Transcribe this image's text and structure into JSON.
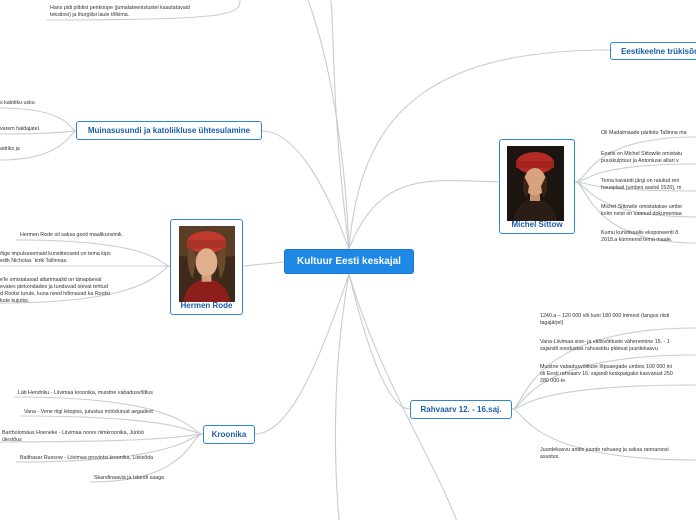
{
  "central": {
    "label": "Kultuur Eesti keskajal"
  },
  "nodes": {
    "eestikeelne": {
      "label": "Eestikeelne trükisõn"
    },
    "muinasusund": {
      "label": "Muinasusundi ja katoliikluse ühtesulamine"
    },
    "kroonika": {
      "label": "Kroonika"
    },
    "rahvaarv": {
      "label": "Rahvaarv 12. - 16.saj."
    },
    "sittow": {
      "label": "Michel Sittow"
    },
    "rode": {
      "label": "Hermen Rode"
    }
  },
  "leaves": {
    "top": [
      "Hans pidi piiblist perikoope (jumalateenistustel kasutatavaid",
      "tekstiosi) ja liturgilisi laule tõlkima."
    ],
    "muinasusund": [
      [
        "s katoliku usku"
      ],
      [
        "varem haldajatel."
      ],
      [
        "adriks ja"
      ]
    ],
    "rode": [
      [
        "Hermen Rode oli saksa gooti maalikunstnik."
      ],
      [
        "õige impulsseemaid kunstiteoseid on tema kips",
        "edik Nicholas ´kirik Tallinnas."
      ],
      [
        "e'le omistatavad altarimaalid on tänapäeval",
        "evates piirkondades ja tunduvad olevat tehtud",
        "d Rootsi turule, kuna need hõlmavad ka Rootsi",
        "kute kujutisi."
      ]
    ],
    "kroonika": [
      [
        "Läti Hendriku - Liivimaa kroonika, muistne vabadusvõitlus"
      ],
      [
        "Vana - Vene riigi letopiss, jutustus möödunud aegadest"
      ],
      [
        "Bartholomäus Hoeneke - Liivimaa noore riimkroonika, Jüriöö",
        "ülestõus"
      ],
      [
        "Balthasar Russow - Liivimaa provintsi kroonika, Liivisõda"
      ],
      [
        "Skandinaavia ja Islandi saaga"
      ]
    ],
    "sittow": [
      [
        "Oli Madalmaade päritolu Tallinna ma"
      ],
      [
        "Eestis on Michel Sittowile omistatu",
        "puuskulptuur ja Antoniuse altari v"
      ],
      [
        "Tema kavandi järgi on raiutud ren",
        "hauaplaat (umbes aastal 1520), m"
      ],
      [
        "Michel Sittowile omistatakse umbe",
        "kolm neist on saanud dokumentaa"
      ],
      [
        "Kumu kunstisaalis eksponeeriti 8.",
        "2018.a kümnenid tema maale."
      ]
    ],
    "rahvaarv": [
      [
        "1240.a – 120 000 või kuni 180 000 inimest (langus riisti",
        "tagajärjel)"
      ],
      [
        "Vana-Liivimaa sise- ja välisvõitluste vähenemine 15. - 1",
        "sajandil soodustas rahvastiku pidevat juurdekasvu."
      ],
      [
        "Muistne vabadusvõitluse lõpuaegade umbes 100 000 ini",
        "oli Eesti rahvaarv 16. sajandi keskpaigaks kasvanud 250",
        "280 000-le."
      ],
      [
        "Juurdekasvu andis juurde rahuaeg ja saksa rannaroosi",
        "asustus."
      ]
    ]
  },
  "colors": {
    "central_fill": "#1e88e5",
    "accent": "#2f86d6",
    "link": "#c9ccd3",
    "card_red_hat": "#c0392b"
  }
}
